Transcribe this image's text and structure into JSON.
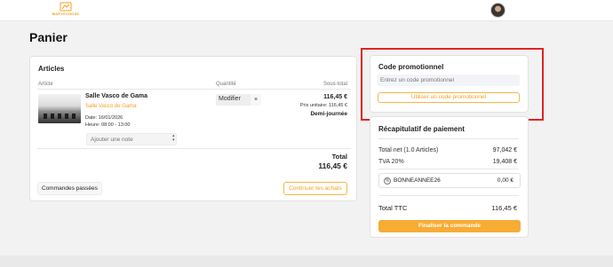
{
  "header": {
    "logo_text": "MAPYECHOSE",
    "avatar_icon": "user-avatar"
  },
  "page": {
    "title": "Panier"
  },
  "articles": {
    "title": "Articles",
    "columns": {
      "article": "Article",
      "quantity": "Quantité",
      "subtotal": "Sous-total"
    },
    "item": {
      "name": "Salle Vasco de Gama",
      "subtitle": "Salle Vasco de Gama",
      "date": "Date: 16/01/2026",
      "time": "Heure: 08:00 - 13:00",
      "quantity_label": "Modifier",
      "remove_label": "×",
      "price": "116,45 €",
      "unit_price": "Prix unitaire: 116,45 €",
      "duration": "Demi-journée",
      "note_placeholder": "Ajouter une note"
    },
    "total_label": "Total",
    "total_value": "116,45 €",
    "history_button": "Commandes passées",
    "continue_button": "Continuer tes achats"
  },
  "promo": {
    "title": "Code promotionnel",
    "input_placeholder": "Entrez un code promotionnel",
    "button_label": "Utiliser un code promotionnel"
  },
  "recap": {
    "title": "Récapitulatif de paiement",
    "net_label": "Total net (1.0 Articles)",
    "net_value": "97,042 €",
    "tva_label": "TVA 20%",
    "tva_value": "19,408 €",
    "coupon_code": "BONNEANNEE26",
    "coupon_value": "0,00 €",
    "ttc_label": "Total TTC",
    "ttc_value": "116,45 €",
    "checkout_button": "Finaliser la commande"
  },
  "colors": {
    "accent": "#f59f1c",
    "highlight": "#e02424"
  }
}
